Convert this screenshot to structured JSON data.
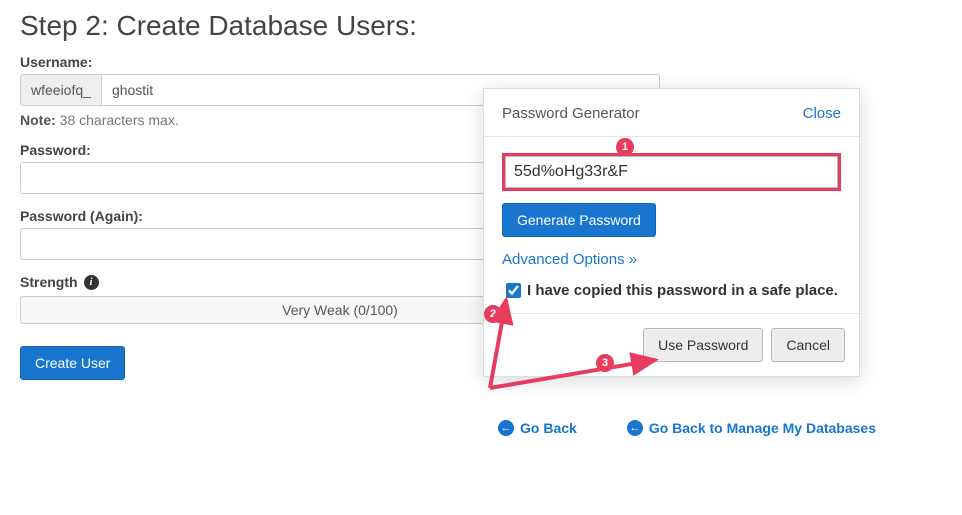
{
  "page": {
    "title": "Step 2: Create Database Users:"
  },
  "username": {
    "label": "Username:",
    "prefix": "wfeeiofq_",
    "value": "ghostit",
    "note_prefix": "Note:",
    "note_text": " 38 characters max."
  },
  "password": {
    "label": "Password:",
    "value": ""
  },
  "password2": {
    "label": "Password (Again):",
    "value": ""
  },
  "strength": {
    "label": "Strength",
    "value_text": "Very Weak (0/100)"
  },
  "buttons": {
    "create_user": "Create User"
  },
  "footer": {
    "go_back": "Go Back",
    "go_back_manage": "Go Back to Manage My Databases"
  },
  "modal": {
    "title": "Password Generator",
    "close": "Close",
    "generated_value": "55d%oHg33r&F",
    "generate_btn": "Generate Password",
    "advanced": "Advanced Options »",
    "copied_label": "I have copied this password in a safe place.",
    "use_password": "Use Password",
    "cancel": "Cancel"
  },
  "annotations": {
    "dot1": "1",
    "dot2": "2",
    "dot3": "3"
  }
}
